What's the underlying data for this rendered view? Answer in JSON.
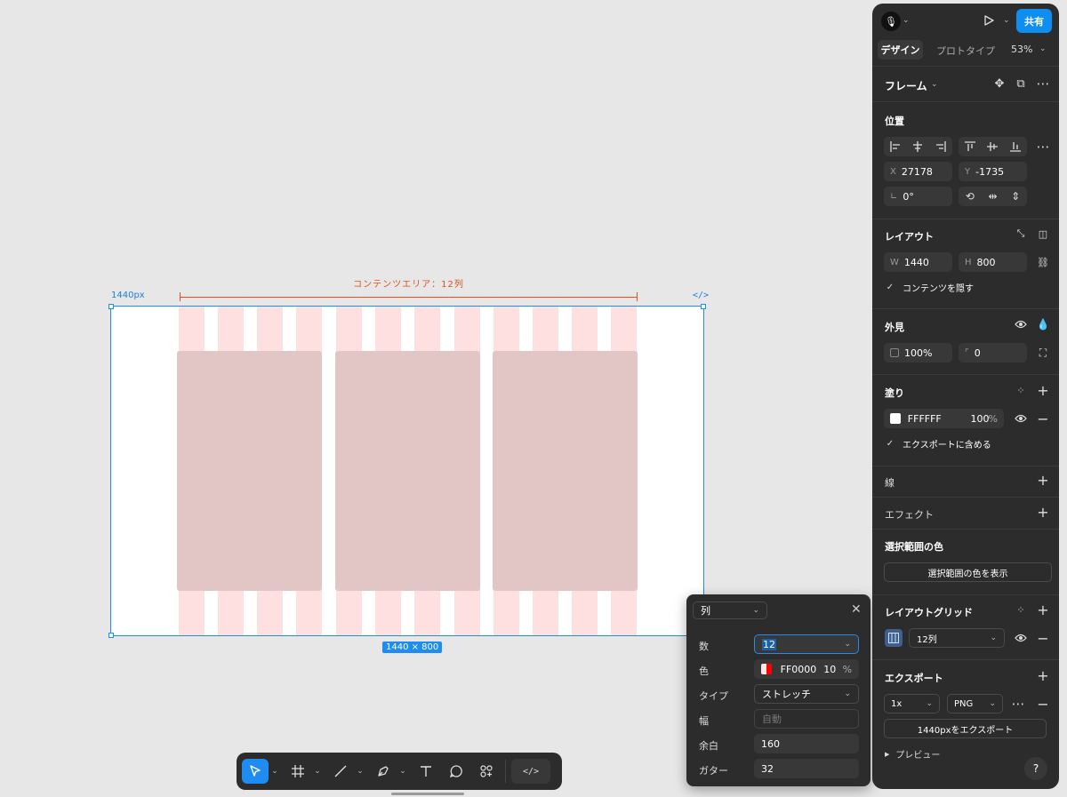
{
  "canvas": {
    "frame_name": "1440px",
    "code_glyph": "</>",
    "measure_label": "コンテンツエリア：12列",
    "dimension_badge": "1440 × 800",
    "grid_color": "#ffdada",
    "selection_color": "#1e8cf0"
  },
  "toolbar": {
    "tools": [
      "move-icon",
      "frame-icon",
      "line-icon",
      "pen-icon",
      "text-icon",
      "comment-icon",
      "actions-icon"
    ],
    "dev_mode_glyph": "</>"
  },
  "grid_popup": {
    "type_select": "列",
    "rows": {
      "count": {
        "label": "数",
        "value": "12"
      },
      "color": {
        "label": "色",
        "hex": "FF0000",
        "opacity": "10",
        "unit": "%"
      },
      "type": {
        "label": "タイプ",
        "value": "ストレッチ"
      },
      "width": {
        "label": "幅",
        "placeholder": "自動"
      },
      "margin": {
        "label": "余白",
        "value": "160"
      },
      "gutter": {
        "label": "ガター",
        "value": "32"
      }
    }
  },
  "panel": {
    "share_label": "共有",
    "tabs": {
      "design": "デザイン",
      "prototype": "プロトタイプ",
      "zoom": "53%"
    },
    "frame_label": "フレーム",
    "position": {
      "title": "位置",
      "x_label": "X",
      "x": "27178",
      "y_label": "Y",
      "y": "-1735",
      "rotation": "0°"
    },
    "layout": {
      "title": "レイアウト",
      "w_label": "W",
      "w": "1440",
      "h_label": "H",
      "h": "800",
      "clip_label": "コンテンツを隠す"
    },
    "appearance": {
      "title": "外見",
      "opacity": "100%",
      "radius": "0"
    },
    "fill": {
      "title": "塗り",
      "hex": "FFFFFF",
      "opacity": "100",
      "unit": "%",
      "export_label": "エクスポートに含める"
    },
    "stroke": {
      "title": "線"
    },
    "effects": {
      "title": "エフェクト"
    },
    "selection_colors": {
      "title": "選択範囲の色",
      "button": "選択範囲の色を表示"
    },
    "layout_grid": {
      "title": "レイアウトグリッド",
      "value": "12列"
    },
    "export": {
      "title": "エクスポート",
      "scale": "1x",
      "format": "PNG",
      "button": "1440pxをエクスポート",
      "preview": "プレビュー"
    },
    "help": "?"
  }
}
